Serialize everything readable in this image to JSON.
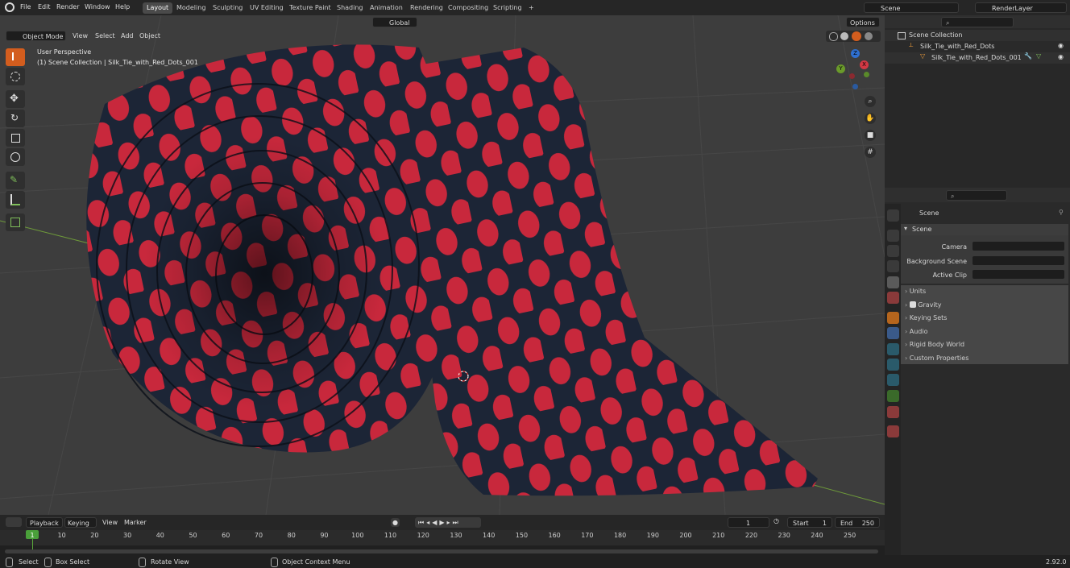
{
  "menu": [
    "File",
    "Edit",
    "Render",
    "Window",
    "Help"
  ],
  "workspaces": [
    "Layout",
    "Modeling",
    "Sculpting",
    "UV Editing",
    "Texture Paint",
    "Shading",
    "Animation",
    "Rendering",
    "Compositing",
    "Scripting"
  ],
  "add_workspace": "+",
  "scene_name": "Scene",
  "view_layer": "RenderLayer",
  "viewport": {
    "mode": "Object Mode",
    "menus": [
      "View",
      "Select",
      "Add",
      "Object"
    ],
    "orientation": "Global",
    "options": "Options",
    "perspective": "User Perspective",
    "collection_path": "(1) Scene Collection | Silk_Tie_with_Red_Dots_001",
    "gizmo": {
      "x": "X",
      "y": "Y",
      "z": "Z"
    }
  },
  "outliner": {
    "root": "Scene Collection",
    "items": [
      {
        "label": "Silk_Tie_with_Red_Dots",
        "level": 1
      },
      {
        "label": "Silk_Tie_with_Red_Dots_001",
        "level": 2
      }
    ]
  },
  "properties": {
    "context": "Scene",
    "panel": "Scene",
    "fields": [
      {
        "label": "Camera",
        "value": ""
      },
      {
        "label": "Background Scene",
        "value": ""
      },
      {
        "label": "Active Clip",
        "value": ""
      }
    ],
    "subpanels": [
      "Units",
      "Gravity",
      "Keying Sets",
      "Audio",
      "Rigid Body World",
      "Custom Properties"
    ],
    "gravity_checked": true
  },
  "timeline": {
    "menus": [
      "Playback",
      "Keying",
      "View",
      "Marker"
    ],
    "current_frame": "1",
    "start_label": "Start",
    "start": "1",
    "end_label": "End",
    "end": "250",
    "ticks": [
      "1",
      "10",
      "20",
      "30",
      "40",
      "50",
      "60",
      "70",
      "80",
      "90",
      "100",
      "110",
      "120",
      "130",
      "140",
      "150",
      "160",
      "170",
      "180",
      "190",
      "200",
      "210",
      "220",
      "230",
      "240",
      "250"
    ]
  },
  "status": {
    "items": [
      "Select",
      "Box Select",
      "Rotate View",
      "Object Context Menu"
    ],
    "version": "2.92.0"
  },
  "colors": {
    "accent": "#d35d1e",
    "tie": "#1c2536",
    "dots": "#c8283c",
    "viewport_bg": "#3d3d3d"
  }
}
